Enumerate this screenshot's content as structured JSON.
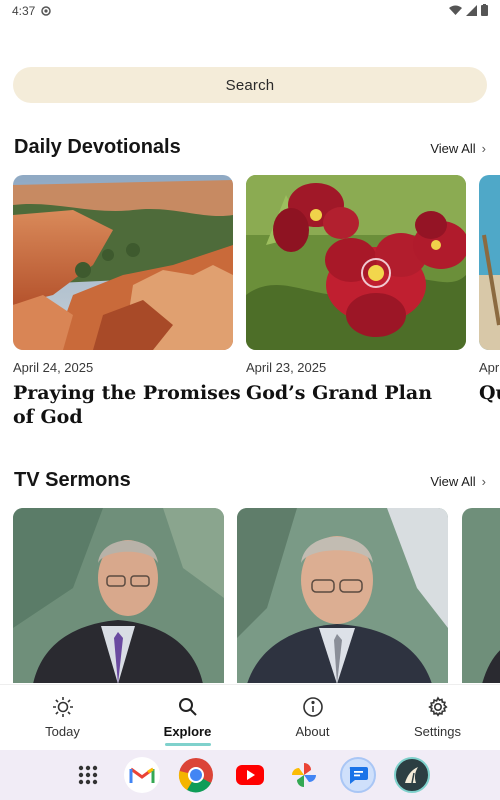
{
  "status": {
    "time": "4:37"
  },
  "search": {
    "label": "Search"
  },
  "devotionals": {
    "heading": "Daily Devotionals",
    "view_all": "View All",
    "cards": [
      {
        "date": "April 24, 2025",
        "title": "Praying the Promises of God"
      },
      {
        "date": "April 23, 2025",
        "title": "God’s Grand Plan"
      },
      {
        "date": "Apr",
        "title": "Qu Sa"
      }
    ]
  },
  "sermons": {
    "heading": "TV Sermons",
    "view_all": "View All"
  },
  "nav": {
    "items": [
      {
        "label": "Today",
        "icon": "sun-icon"
      },
      {
        "label": "Explore",
        "icon": "search-icon"
      },
      {
        "label": "About",
        "icon": "info-icon"
      },
      {
        "label": "Settings",
        "icon": "gear-icon"
      }
    ],
    "active": "Explore"
  },
  "taskbar": {
    "apps": [
      "app-grid-icon",
      "gmail-icon",
      "chrome-icon",
      "youtube-icon",
      "photos-icon",
      "messages-icon",
      "app-icon"
    ]
  },
  "colors": {
    "search_bg": "#f4ecd9",
    "nav_indicator": "#7fd1cc",
    "taskbar_bg": "#f1ecf6"
  }
}
